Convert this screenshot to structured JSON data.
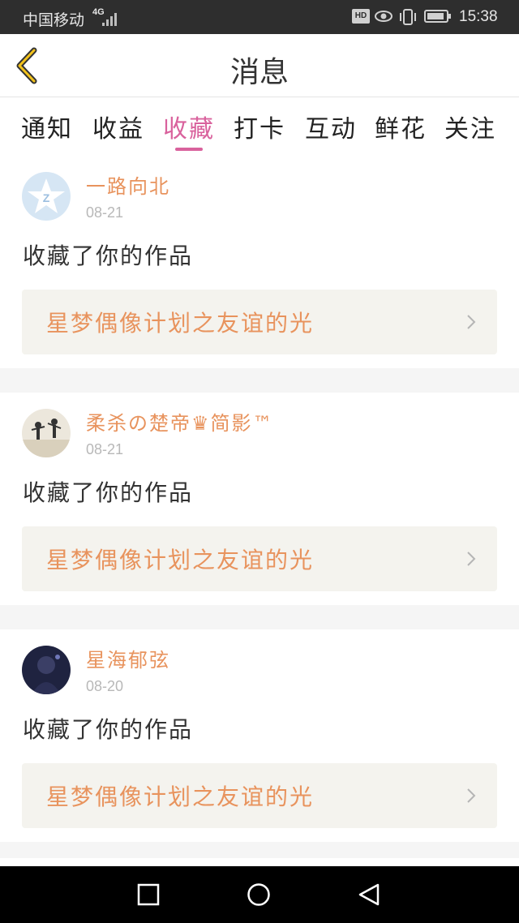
{
  "status_bar": {
    "carrier": "中国移动",
    "network": "4G",
    "time": "15:38",
    "hd_badge": "HD"
  },
  "header": {
    "title": "消息",
    "back_icon": "chevron-left-icon"
  },
  "tabs": [
    {
      "label": "通知",
      "active": false
    },
    {
      "label": "收益",
      "active": false
    },
    {
      "label": "收藏",
      "active": true
    },
    {
      "label": "打卡",
      "active": false
    },
    {
      "label": "互动",
      "active": false
    },
    {
      "label": "鲜花",
      "active": false
    },
    {
      "label": "关注",
      "active": false
    }
  ],
  "messages": [
    {
      "username": "一路向北",
      "date": "08-21",
      "action": "收藏了你的作品",
      "work_title": "星梦偶像计划之友谊的光"
    },
    {
      "username": "柔杀の楚帝♛简影™",
      "date": "08-21",
      "action": "收藏了你的作品",
      "work_title": "星梦偶像计划之友谊的光"
    },
    {
      "username": "星海郁弦",
      "date": "08-20",
      "action": "收藏了你的作品",
      "work_title": "星梦偶像计划之友谊的光"
    }
  ],
  "colors": {
    "accent": "#d9629d",
    "username": "#e8935d",
    "work_bg": "#f4f3ee"
  }
}
